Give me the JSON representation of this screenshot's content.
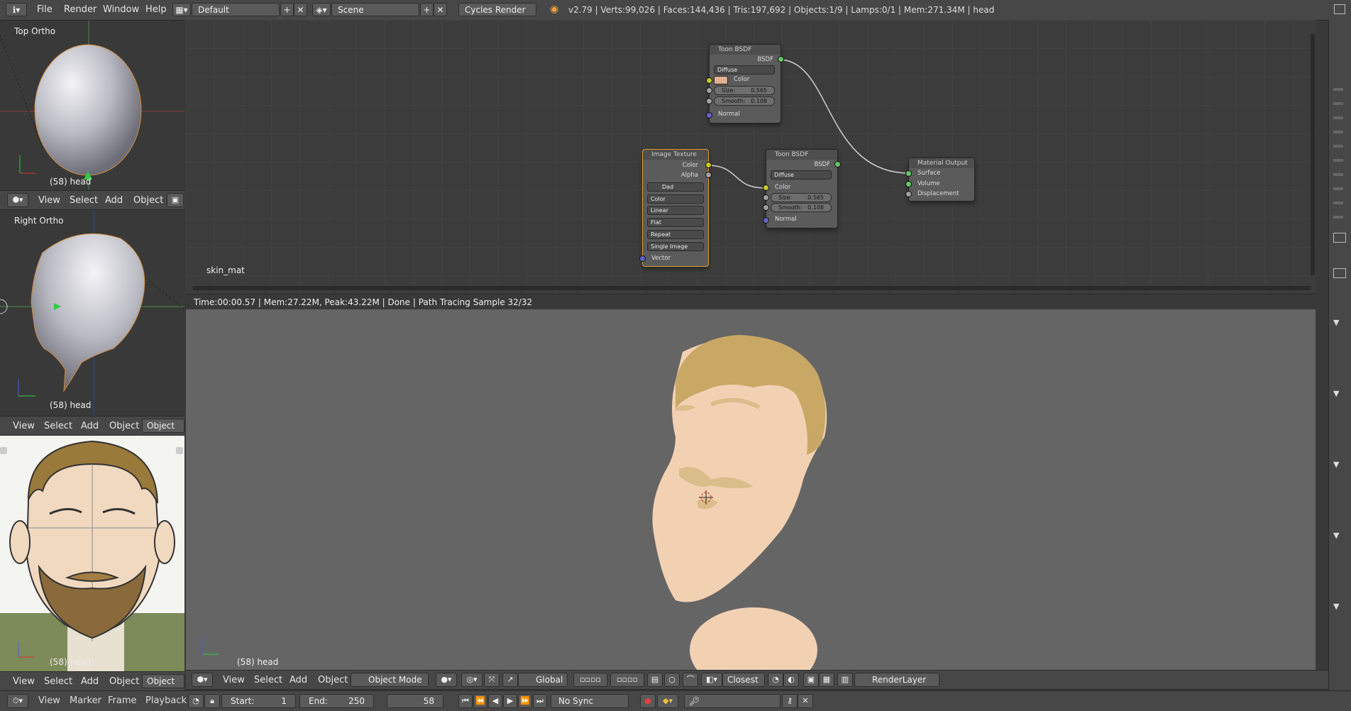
{
  "topbar": {
    "menus": [
      "File",
      "Render",
      "Window",
      "Help"
    ],
    "layout": "Default",
    "scene": "Scene",
    "engine": "Cycles Render",
    "stats": "v2.79 | Verts:99,026 | Faces:144,436 | Tris:197,692 | Objects:1/9 | Lamps:0/1 | Mem:271.34M | head"
  },
  "viewports": {
    "top": {
      "label": "Top Ortho",
      "object": "(58) head"
    },
    "right": {
      "label": "Right Ortho",
      "object": "(58) head"
    },
    "reference": {
      "object": "(58) head"
    },
    "header_items": [
      "View",
      "Select",
      "Add",
      "Object"
    ],
    "mode_short": "Object"
  },
  "node_editor": {
    "material": "skin_mat",
    "toon1": {
      "title": "Toon BSDF",
      "out": "BSDF",
      "dist": "Diffuse",
      "color": "Color",
      "size_label": "Size:",
      "size": "0.565",
      "smooth_label": "Smooth:",
      "smooth": "0.108",
      "normal": "Normal"
    },
    "toon2": {
      "title": "Toon BSDF",
      "out": "BSDF",
      "dist": "Diffuse",
      "color": "Color",
      "size_label": "Size:",
      "size": "0.565",
      "smooth_label": "Smooth:",
      "smooth": "0.108",
      "normal": "Normal"
    },
    "image": {
      "title": "Image Texture",
      "out_color": "Color",
      "out_alpha": "Alpha",
      "img": "Dad",
      "opts": [
        "Color",
        "Linear",
        "Flat",
        "Repeat",
        "Single Image"
      ],
      "vector": "Vector"
    },
    "output": {
      "title": "Material Output",
      "surface": "Surface",
      "volume": "Volume",
      "displacement": "Displacement"
    }
  },
  "render_view": {
    "status": "Time:00:00.57 | Mem:27.22M, Peak:43.22M | Done | Path Tracing Sample 32/32",
    "object": "(58) head",
    "header_items": [
      "View",
      "Select",
      "Add",
      "Object"
    ],
    "mode": "Object Mode",
    "orientation": "Global",
    "snap": "Closest",
    "render_layer": "RenderLayer"
  },
  "timeline": {
    "items": [
      "View",
      "Marker",
      "Frame",
      "Playback"
    ],
    "start_label": "Start:",
    "start": "1",
    "end_label": "End:",
    "end": "250",
    "current": "58",
    "sync": "No Sync"
  },
  "colors": {
    "bg": "#393939",
    "header": "#474747",
    "render_bg": "#656565",
    "skin": "#f2d1b3",
    "hair": "#c9a866"
  }
}
